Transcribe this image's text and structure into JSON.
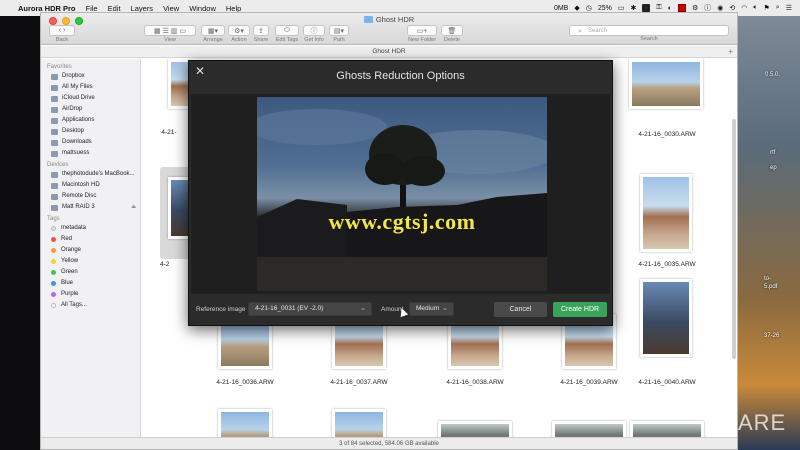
{
  "menubar": {
    "app_name": "Aurora HDR Pro",
    "menus": [
      "File",
      "Edit",
      "Layers",
      "View",
      "Window",
      "Help"
    ],
    "status_items": [
      "0MB",
      "25%"
    ]
  },
  "window": {
    "title": "Ghost HDR",
    "path_title": "Ghost HDR",
    "toolbar": {
      "back_label": "Back",
      "view_label": "View",
      "arrange_label": "Arrange",
      "action_label": "Action",
      "share_label": "Share",
      "edit_tags_label": "Edit Tags",
      "get_info_label": "Get Info",
      "path_label": "Path",
      "new_folder_label": "New Folder",
      "delete_label": "Delete",
      "search_label": "Search",
      "search_placeholder": "Search"
    },
    "status_bar": "3 of 84 selected, 584.06 GB available"
  },
  "sidebar": {
    "favorites_header": "Favorites",
    "favorites": [
      "Dropbox",
      "All My Files",
      "iCloud Drive",
      "AirDrop",
      "Applications",
      "Desktop",
      "Downloads",
      "mattsuess"
    ],
    "devices_header": "Devices",
    "devices": [
      "thephotodude's MacBook...",
      "Macintosh HD",
      "Remote Disc",
      "Matt RAID 3"
    ],
    "tags_header": "Tags",
    "tags": [
      {
        "name": "metadata",
        "color": "#e0e0e0"
      },
      {
        "name": "Red",
        "color": "#ff4b4b"
      },
      {
        "name": "Orange",
        "color": "#ff9a2e"
      },
      {
        "name": "Yellow",
        "color": "#f3d22c"
      },
      {
        "name": "Green",
        "color": "#40c553"
      },
      {
        "name": "Blue",
        "color": "#3d8ff5"
      },
      {
        "name": "Purple",
        "color": "#b865e0"
      },
      {
        "name": "All Tags...",
        "color": "#bdbdbd"
      }
    ]
  },
  "files": {
    "row1": [
      "4-21-",
      "4-21-16_0030.ARW"
    ],
    "row2": [
      "4-21-16_0035.ARW"
    ],
    "row3": [
      "4-21-16_0036.ARW",
      "4-21-16_0037.ARW",
      "4-21-16_0038.ARW",
      "4-21-16_0039.ARW",
      "4-21-16_0040.ARW"
    ],
    "selected_partial": "4-2"
  },
  "dialog": {
    "title": "Ghosts Reduction Options",
    "reference_label": "Reference image",
    "reference_value": "4-21-16_0031 (EV -2.0)",
    "amount_label": "Amount",
    "amount_value": "Medium",
    "cancel_label": "Cancel",
    "create_label": "Create HDR",
    "watermark": "www.cgtsj.com"
  },
  "desktop": {
    "items": [
      "0.5.0.",
      "rtf",
      "ep",
      "to-",
      "5.pdf",
      "37-26"
    ],
    "logo": "ARE"
  },
  "colors": {
    "create_button": "#3aa35a",
    "dialog_bg": "#2b2b2b",
    "watermark": "#f1e64a"
  }
}
